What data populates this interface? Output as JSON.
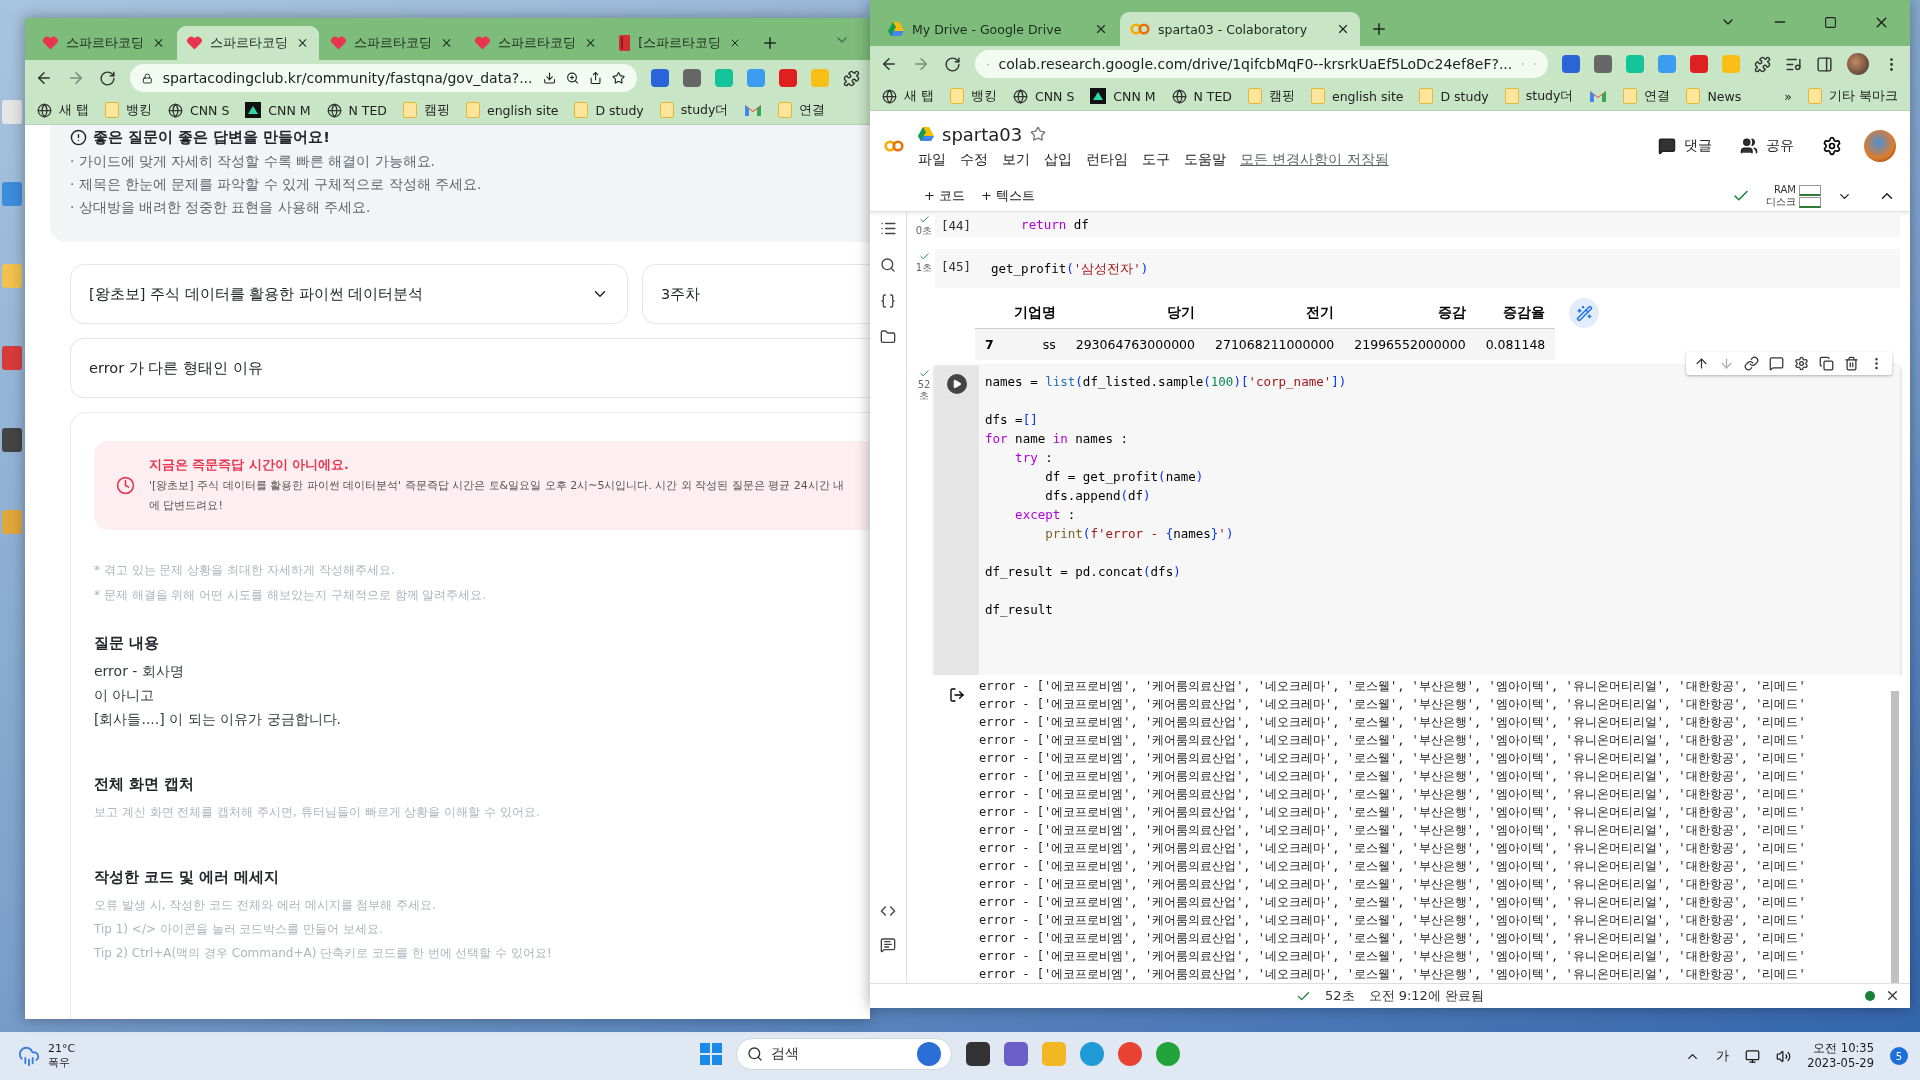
{
  "left_window": {
    "tabs": [
      {
        "label": "스파르타코딩",
        "kind": "sparta",
        "selected": false
      },
      {
        "label": "스파르타코딩",
        "kind": "sparta",
        "selected": true
      },
      {
        "label": "스파르타코딩",
        "kind": "sparta",
        "selected": false
      },
      {
        "label": "스파르타코딩",
        "kind": "sparta",
        "selected": false
      },
      {
        "label": "[스파르타코딩",
        "kind": "book",
        "selected": false
      }
    ],
    "address": "spartacodingclub.kr/community/fastqna/gov_data?...",
    "bookmarks": [
      {
        "label": "새 탭",
        "kind": "globe"
      },
      {
        "label": "뱅킹",
        "kind": "folder"
      },
      {
        "label": "CNN S",
        "kind": "globe"
      },
      {
        "label": "CNN M",
        "kind": "app"
      },
      {
        "label": "N TED",
        "kind": "globe"
      },
      {
        "label": "캠핑",
        "kind": "folder"
      },
      {
        "label": "english site",
        "kind": "folder"
      },
      {
        "label": "D study",
        "kind": "folder"
      },
      {
        "label": "study더",
        "kind": "folder"
      },
      {
        "kind": "gmail"
      },
      {
        "label": "연결",
        "kind": "folder"
      }
    ],
    "page": {
      "notice": {
        "title": "좋은 질문이 좋은 답변을 만들어요!",
        "items": [
          "· 가이드에 맞게 자세히 작성할 수록 빠른 해결이 가능해요.",
          "· 제목은 한눈에 문제를 파악할 수 있게 구체적으로 작성해 주세요.",
          "· 상대방을 배려한 정중한 표현을 사용해 주세요."
        ]
      },
      "course": "[왕초보] 주식 데이터를 활용한 파이썬 데이터분석",
      "week": "3주차",
      "question_title": "error 가 다른 형태인 이유",
      "alert": {
        "title": "지금은 즉문즉답 시간이 아니에요.",
        "lines": [
          "'[왕초보] 주식 데이터를 활용한 파이썬 데이터분석' 즉문즉답 시간은 토&일요일 오후 2시~5시입니다. 시간 외 작성된 질문은 평균 24시간 내",
          "에 답변드려요!"
        ]
      },
      "hints": [
        "* 겪고 있는 문제 상황을 최대한 자세하게 작성해주세요.",
        "* 문제 해결을 위해 어떤 시도를 해보았는지 구체적으로 함께 알려주세요."
      ],
      "sections": [
        {
          "heading": "질문 내용",
          "kind": "body",
          "lines": [
            "error -  회사명",
            "이 아니고",
            "[회사들....] 이 되는 이유가 궁금합니다."
          ]
        },
        {
          "heading": "전체 화면 캡처",
          "kind": "hint",
          "lines": [
            "보고 계신 화면 전체를 캡처해 주시면, 튜터님들이 빠르게 상황을 이해할 수 있어요."
          ]
        },
        {
          "heading": "작성한 코드 및 에러 메세지",
          "kind": "hint",
          "lines": [
            "오류 발생 시, 작성한 코드 전체와 에러 메시지를 첨부해 주세요.",
            "Tip 1) </> 아이콘을 눌러 코드박스를 만들어 보세요.",
            "Tip 2) Ctrl+A(맥의 경우 Command+A) 단축키로 코드를 한 번에 선택할 수 있어요!"
          ]
        }
      ]
    }
  },
  "colab_window": {
    "tabs": [
      {
        "label": "My Drive - Google Drive",
        "kind": "drive",
        "selected": false
      },
      {
        "label": "sparta03 - Colaboratory",
        "kind": "colab",
        "selected": true
      }
    ],
    "address": "colab.research.google.com/drive/1qifcbMqF0--krsrkUaEf5LoDc24ef8eF?...",
    "bookmarks": [
      {
        "label": "새 탭",
        "kind": "globe"
      },
      {
        "label": "뱅킹",
        "kind": "folder"
      },
      {
        "label": "CNN S",
        "kind": "globe"
      },
      {
        "label": "CNN M",
        "kind": "app"
      },
      {
        "label": "N TED",
        "kind": "globe"
      },
      {
        "label": "캠핑",
        "kind": "folder"
      },
      {
        "label": "english site",
        "kind": "folder"
      },
      {
        "label": "D study",
        "kind": "folder"
      },
      {
        "label": "study더",
        "kind": "folder"
      },
      {
        "kind": "gmail"
      },
      {
        "label": "연결",
        "kind": "folder"
      },
      {
        "label": "News",
        "kind": "folder"
      }
    ],
    "bookmarks_overflow": "»",
    "other_bookmarks": "기타 북마크",
    "notebook": {
      "title": "sparta03",
      "menu": [
        "파일",
        "수정",
        "보기",
        "삽입",
        "런타임",
        "도구",
        "도움말"
      ],
      "save_status": "모든 변경사항이 저장됨",
      "comment": "댓글",
      "share": "공유",
      "add_code": "+ 코드",
      "add_text": "+ 텍스트",
      "ram": "RAM",
      "disk": "디스크",
      "cells": [
        {
          "count": "[44]",
          "time": "0초",
          "lines": [
            {
              "blank_before": false,
              "tokens": [
                {
                  "kind": "kw",
                  "s": "    return"
                },
                {
                  "kind": "plain",
                  "s": " df"
                }
              ]
            }
          ]
        },
        {
          "count": "[45]",
          "time": "1초",
          "lines": [
            {
              "blank_before": false,
              "tokens": [
                {
                  "kind": "plain",
                  "s": "get_profit"
                },
                {
                  "kind": "br",
                  "s": "("
                },
                {
                  "kind": "str",
                  "s": "'삼성전자'"
                },
                {
                  "kind": "br",
                  "s": ")"
                }
              ]
            }
          ],
          "table": {
            "columns": [
              "",
              "기업명",
              "당기",
              "전기",
              "증감",
              "증감율"
            ],
            "rows": [
              [
                "7",
                "ss",
                "293064763000000",
                "271068211000000",
                "21996552000000",
                "0.081148"
              ]
            ]
          }
        },
        {
          "time": "52초",
          "lines": [
            {
              "blank_before": false,
              "tokens": [
                {
                  "kind": "plain",
                  "s": "names = "
                },
                {
                  "kind": "builtin",
                  "s": "list"
                },
                {
                  "kind": "br",
                  "s": "("
                },
                {
                  "kind": "plain",
                  "s": "df_listed.sample"
                },
                {
                  "kind": "br",
                  "s": "("
                },
                {
                  "kind": "num",
                  "s": "100"
                },
                {
                  "kind": "br",
                  "s": ")"
                },
                {
                  "kind": "br",
                  "s": "["
                },
                {
                  "kind": "str",
                  "s": "'corp_name'"
                },
                {
                  "kind": "br",
                  "s": "])"
                }
              ]
            },
            {
              "blank_before": true,
              "tokens": [
                {
                  "kind": "plain",
                  "s": "dfs ="
                },
                {
                  "kind": "br",
                  "s": "[]"
                }
              ]
            },
            {
              "blank_before": false,
              "tokens": [
                {
                  "kind": "kw",
                  "s": "for"
                },
                {
                  "kind": "plain",
                  "s": " name "
                },
                {
                  "kind": "kw",
                  "s": "in"
                },
                {
                  "kind": "plain",
                  "s": " names :"
                }
              ]
            },
            {
              "blank_before": false,
              "tokens": [
                {
                  "kind": "kw",
                  "s": "    try"
                },
                {
                  "kind": "plain",
                  "s": " :"
                }
              ]
            },
            {
              "blank_before": false,
              "tokens": [
                {
                  "kind": "plain",
                  "s": "        df = get_profit"
                },
                {
                  "kind": "br",
                  "s": "("
                },
                {
                  "kind": "plain",
                  "s": "name"
                },
                {
                  "kind": "br",
                  "s": ")"
                }
              ]
            },
            {
              "blank_before": false,
              "tokens": [
                {
                  "kind": "plain",
                  "s": "        dfs.append"
                },
                {
                  "kind": "br",
                  "s": "("
                },
                {
                  "kind": "plain",
                  "s": "df"
                },
                {
                  "kind": "br",
                  "s": ")"
                }
              ]
            },
            {
              "blank_before": false,
              "tokens": [
                {
                  "kind": "kw",
                  "s": "    except"
                },
                {
                  "kind": "plain",
                  "s": " :"
                }
              ]
            },
            {
              "blank_before": false,
              "tokens": [
                {
                  "kind": "fn",
                  "s": "        print"
                },
                {
                  "kind": "br",
                  "s": "("
                },
                {
                  "kind": "str",
                  "s": "f'error - "
                },
                {
                  "kind": "br",
                  "s": "{"
                },
                {
                  "kind": "plain",
                  "s": "names"
                },
                {
                  "kind": "br",
                  "s": "}"
                },
                {
                  "kind": "str",
                  "s": "'"
                },
                {
                  "kind": "br",
                  "s": ")"
                }
              ]
            },
            {
              "blank_before": true,
              "tokens": [
                {
                  "kind": "plain",
                  "s": "df_result = pd.concat"
                },
                {
                  "kind": "br",
                  "s": "("
                },
                {
                  "kind": "plain",
                  "s": "dfs"
                },
                {
                  "kind": "br",
                  "s": ")"
                }
              ]
            },
            {
              "blank_before": true,
              "tokens": [
                {
                  "kind": "plain",
                  "s": "df_result"
                }
              ]
            }
          ],
          "output": [
            "error - ['에코프로비엠', '케어룸의료산업', '네오크레마', '로스웰', '부산은행', '엠아이텍', '유니온머티리얼', '대한항공', '리메드'",
            "error - ['에코프로비엠', '케어룸의료산업', '네오크레마', '로스웰', '부산은행', '엠아이텍', '유니온머티리얼', '대한항공', '리메드'",
            "error - ['에코프로비엠', '케어룸의료산업', '네오크레마', '로스웰', '부산은행', '엠아이텍', '유니온머티리얼', '대한항공', '리메드'",
            "error - ['에코프로비엠', '케어룸의료산업', '네오크레마', '로스웰', '부산은행', '엠아이텍', '유니온머티리얼', '대한항공', '리메드'",
            "error - ['에코프로비엠', '케어룸의료산업', '네오크레마', '로스웰', '부산은행', '엠아이텍', '유니온머티리얼', '대한항공', '리메드'",
            "error - ['에코프로비엠', '케어룸의료산업', '네오크레마', '로스웰', '부산은행', '엠아이텍', '유니온머티리얼', '대한항공', '리메드'",
            "error - ['에코프로비엠', '케어룸의료산업', '네오크레마', '로스웰', '부산은행', '엠아이텍', '유니온머티리얼', '대한항공', '리메드'",
            "error - ['에코프로비엠', '케어룸의료산업', '네오크레마', '로스웰', '부산은행', '엠아이텍', '유니온머티리얼', '대한항공', '리메드'",
            "error - ['에코프로비엠', '케어룸의료산업', '네오크레마', '로스웰', '부산은행', '엠아이텍', '유니온머티리얼', '대한항공', '리메드'",
            "error - ['에코프로비엠', '케어룸의료산업', '네오크레마', '로스웰', '부산은행', '엠아이텍', '유니온머티리얼', '대한항공', '리메드'",
            "error - ['에코프로비엠', '케어룸의료산업', '네오크레마', '로스웰', '부산은행', '엠아이텍', '유니온머티리얼', '대한항공', '리메드'",
            "error - ['에코프로비엠', '케어룸의료산업', '네오크레마', '로스웰', '부산은행', '엠아이텍', '유니온머티리얼', '대한항공', '리메드'",
            "error - ['에코프로비엠', '케어룸의료산업', '네오크레마', '로스웰', '부산은행', '엠아이텍', '유니온머티리얼', '대한항공', '리메드'",
            "error - ['에코프로비엠', '케어룸의료산업', '네오크레마', '로스웰', '부산은행', '엠아이텍', '유니온머티리얼', '대한항공', '리메드'",
            "error - ['에코프로비엠', '케어룸의료산업', '네오크레마', '로스웰', '부산은행', '엠아이텍', '유니온머티리얼', '대한항공', '리메드'",
            "error - ['에코프로비엠', '케어룸의료산업', '네오크레마', '로스웰', '부산은행', '엠아이텍', '유니온머티리얼', '대한항공', '리메드'",
            "error - ['에코프로비엠', '케어룸의료산업', '네오크레마', '로스웰', '부산은행', '엠아이텍', '유니온머티리얼', '대한항공', '리메드'"
          ]
        }
      ],
      "status": {
        "duration": "52초",
        "message": "오전 9:12에 완료됨"
      }
    }
  },
  "taskbar": {
    "temperature": "21°C",
    "weather": "폭우",
    "search": "검색",
    "ime": "가",
    "time": "오전 10:35",
    "date": "2023-05-29",
    "badge": "5"
  }
}
